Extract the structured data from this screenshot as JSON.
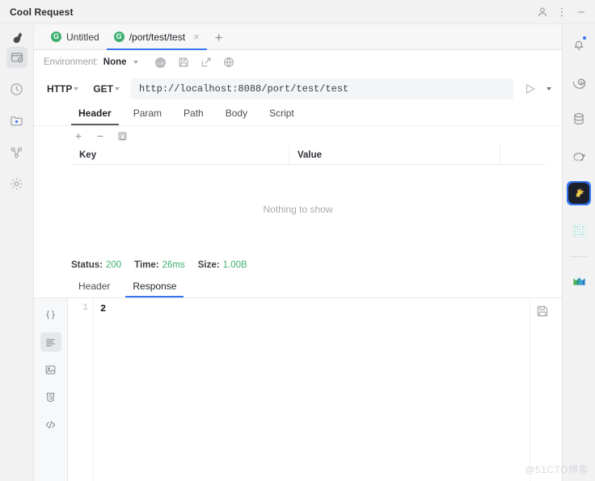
{
  "window": {
    "title": "Cool Request",
    "controls": [
      {
        "name": "account-icon",
        "label": "\u0000"
      },
      {
        "name": "more-menu-icon",
        "label": ""
      },
      {
        "name": "minimize-button",
        "label": ""
      }
    ]
  },
  "left_rail": {
    "logo": "bird-logo",
    "items": [
      {
        "name": "sidebar-item-request",
        "icon": "window-request-icon",
        "selected": true
      },
      {
        "name": "sidebar-item-history",
        "icon": "clock-icon",
        "selected": false
      },
      {
        "name": "sidebar-item-collection",
        "icon": "folder-icon",
        "selected": false
      },
      {
        "name": "sidebar-item-share",
        "icon": "share-nodes-icon",
        "selected": false
      },
      {
        "name": "sidebar-item-settings",
        "icon": "gear-icon",
        "selected": false
      }
    ]
  },
  "right_rail": {
    "items": [
      {
        "name": "tool-notifications",
        "icon": "bell-icon",
        "badge": true,
        "selected": false
      },
      {
        "name": "tool-spiral",
        "icon": "spiral-icon",
        "badge": false,
        "selected": false
      },
      {
        "name": "tool-database",
        "icon": "database-icon",
        "badge": false,
        "selected": false
      },
      {
        "name": "tool-postgres",
        "icon": "elephant-icon",
        "badge": false,
        "selected": false
      },
      {
        "name": "tool-cool-request",
        "icon": "cool-request-logo-icon",
        "badge": false,
        "selected": true
      },
      {
        "name": "tool-qr",
        "icon": "qr-code-icon",
        "badge": false,
        "selected": false
      },
      {
        "name": "tool-maven",
        "icon": "maven-icon",
        "badge": false,
        "selected": false
      }
    ]
  },
  "request_tabs": {
    "tabs": [
      {
        "method_badge": "G",
        "label": "Untitled",
        "active": false,
        "closable": false
      },
      {
        "method_badge": "G",
        "label": "/port/test/test",
        "active": true,
        "closable": true
      }
    ],
    "close_glyph": "×",
    "add_glyph": "+"
  },
  "environment": {
    "label": "Environment:",
    "value": "None",
    "icons": [
      {
        "name": "curl-icon"
      },
      {
        "name": "save-icon"
      },
      {
        "name": "export-icon"
      },
      {
        "name": "globe-icon"
      }
    ]
  },
  "url_bar": {
    "protocol": "HTTP",
    "method": "GET",
    "url": "http://localhost:8088/port/test/test",
    "placeholder": "http://localhost:8088/port/test/test",
    "send_label": "send-button",
    "send_more_label": "send-options-button"
  },
  "request_subtabs": {
    "tabs": [
      {
        "label": "Header",
        "active": true
      },
      {
        "label": "Param",
        "active": false
      },
      {
        "label": "Path",
        "active": false
      },
      {
        "label": "Body",
        "active": false
      },
      {
        "label": "Script",
        "active": false
      }
    ]
  },
  "kv_toolbar": {
    "add": "+",
    "remove": "−",
    "copy": "copy-icon"
  },
  "kv_table": {
    "columns": [
      "Key",
      "Value"
    ],
    "rows": [],
    "empty_text": "Nothing to show"
  },
  "status": {
    "status_label": "Status:",
    "status_value": "200",
    "time_label": "Time:",
    "time_value": "26ms",
    "size_label": "Size:",
    "size_value": "1.00B",
    "accent_color": "#3caf6f"
  },
  "response_tabs": {
    "tabs": [
      {
        "label": "Header",
        "active": false
      },
      {
        "label": "Response",
        "active": true
      }
    ]
  },
  "response_editor": {
    "view_buttons": [
      {
        "name": "view-json-button",
        "icon": "braces-icon",
        "selected": false
      },
      {
        "name": "view-text-button",
        "icon": "text-lines-icon",
        "selected": true
      },
      {
        "name": "view-image-button",
        "icon": "image-icon",
        "selected": false
      },
      {
        "name": "view-html-button",
        "icon": "html5-icon",
        "selected": false
      },
      {
        "name": "view-code-button",
        "icon": "code-icon",
        "selected": false
      }
    ],
    "save_button": "save-response-icon",
    "lines": [
      {
        "number": "1",
        "text": "2"
      }
    ]
  },
  "watermark": "@51CTO博客"
}
